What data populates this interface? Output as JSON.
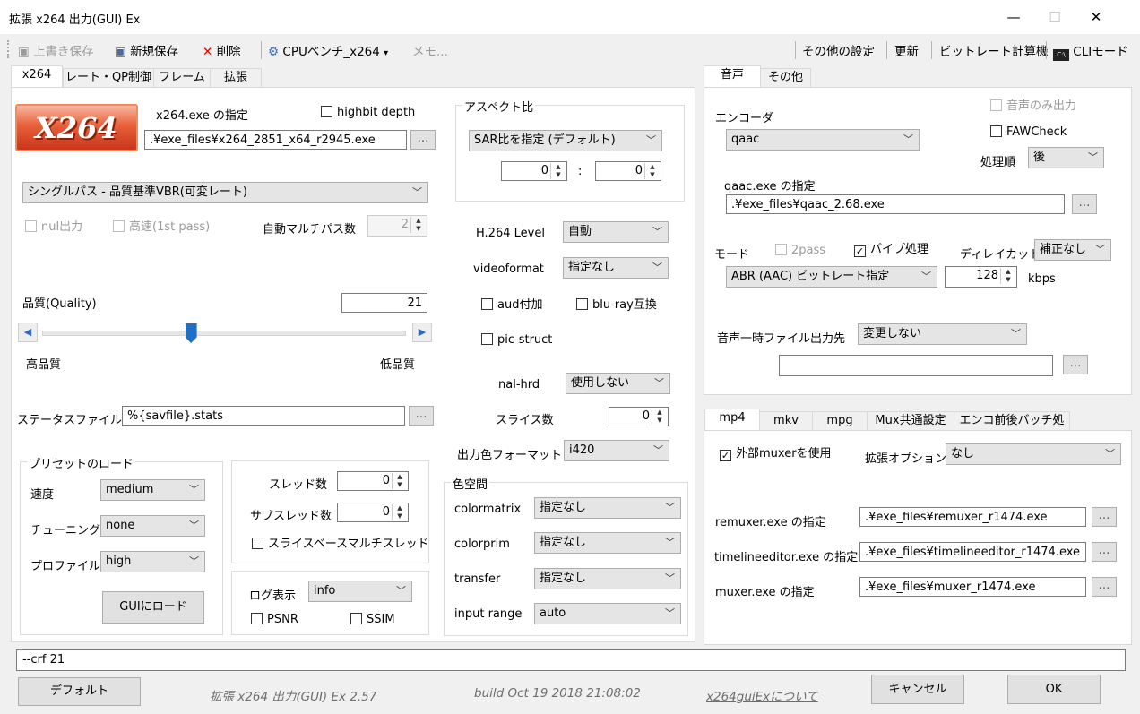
{
  "window": {
    "title": "拡張 x264 出力(GUI) Ex"
  },
  "toolbar": {
    "overwrite": "上書き保存",
    "new_save": "新規保存",
    "delete": "削除",
    "bench": "CPUベンチ_x264",
    "memo": "メモ...",
    "other_settings": "その他の設定",
    "refresh": "更新",
    "bitrate_calc": "ビットレート計算機",
    "cli_mode": "CLIモード"
  },
  "left_tabs": [
    "x264",
    "レート・QP制御",
    "フレーム",
    "拡張"
  ],
  "x264": {
    "logo_text": "X264",
    "exe_label": "x264.exe の指定",
    "exe_path": ".¥exe_files¥x264_2851_x64_r2945.exe",
    "highbit": "highbit depth",
    "mode": "シングルパス - 品質基準VBR(可変レート)",
    "nul": "nul出力",
    "fast": "高速(1st pass)",
    "auto_multipass": "自動マルチパス数",
    "multipass_val": "2",
    "quality_label": "品質(Quality)",
    "quality_value": "21",
    "quality_fraction": 0.41,
    "high_quality": "高品質",
    "low_quality": "低品質",
    "status_file_label": "ステータスファイル",
    "status_file": "%{savfile}.stats",
    "preset_group": "プリセットのロード",
    "speed_label": "速度",
    "speed": "medium",
    "tuning_label": "チューニング",
    "tuning": "none",
    "profile_label": "プロファイル",
    "profile": "high",
    "load_button": "GUIにロード",
    "threads_label": "スレッド数",
    "threads": "0",
    "subthreads_label": "サブスレッド数",
    "subthreads": "0",
    "slice_mt": "スライスベースマルチスレッド",
    "log_label": "ログ表示",
    "log": "info",
    "psnr": "PSNR",
    "ssim": "SSIM"
  },
  "aspect": {
    "group": "アスペクト比",
    "sar": "SAR比を指定 (デフォルト)",
    "w": "0",
    "colon": ":",
    "h": "0"
  },
  "h264": {
    "level_label": "H.264 Level",
    "level": "自動",
    "videoformat_label": "videoformat",
    "videoformat": "指定なし",
    "aud": "aud付加",
    "bluray": "blu-ray互換",
    "picstruct": "pic-struct",
    "nalhrd_label": "nal-hrd",
    "nalhrd": "使用しない",
    "slices_label": "スライス数",
    "slices": "0",
    "outcolor_label": "出力色フォーマット",
    "outcolor": "i420"
  },
  "colorspace": {
    "group": "色空間",
    "matrix_label": "colormatrix",
    "matrix": "指定なし",
    "prim_label": "colorprim",
    "prim": "指定なし",
    "transfer_label": "transfer",
    "transfer": "指定なし",
    "range_label": "input range",
    "range": "auto"
  },
  "audio_tabs": [
    "音声",
    "その他"
  ],
  "audio": {
    "encoder_label": "エンコーダ",
    "encoder": "qaac",
    "audio_only": "音声のみ出力",
    "faw": "FAWCheck",
    "order_label": "処理順",
    "order": "後",
    "exe_label": "qaac.exe の指定",
    "exe_path": ".¥exe_files¥qaac_2.68.exe",
    "mode_label": "モード",
    "twopass": "2pass",
    "pipe": "パイプ処理",
    "delay_label": "ディレイカット",
    "delay": "補正なし",
    "bitrate_mode": "ABR (AAC) ビットレート指定",
    "bitrate": "128",
    "kbps": "kbps",
    "temp_label": "音声一時ファイル出力先",
    "temp": "変更しない",
    "temp_path": ""
  },
  "mux_tabs": [
    "mp4",
    "mkv",
    "mpg",
    "Mux共通設定",
    "エンコ前後バッチ処理"
  ],
  "mux": {
    "external": "外部muxerを使用",
    "ext_opt_label": "拡張オプション",
    "ext_opt": "なし",
    "remuxer_label": "remuxer.exe の指定",
    "remuxer": ".¥exe_files¥remuxer_r1474.exe",
    "tle_label": "timelineeditor.exe の指定",
    "tle": ".¥exe_files¥timelineeditor_r1474.exe",
    "muxer_label": "muxer.exe の指定",
    "muxer": ".¥exe_files¥muxer_r1474.exe"
  },
  "status_cmd": "--crf 21",
  "footer": {
    "default": "デフォルト",
    "version": "拡張 x264 出力(GUI) Ex 2.57",
    "build": "build Oct 19 2018 21:08:02",
    "about": "x264guiExについて",
    "cancel": "キャンセル",
    "ok": "OK"
  }
}
